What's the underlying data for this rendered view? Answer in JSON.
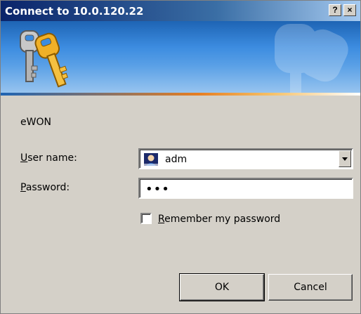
{
  "window": {
    "title": "Connect to 10.0.120.22",
    "help_label": "?",
    "close_label": "×"
  },
  "dialog": {
    "realm": "eWON",
    "username_label_first": "U",
    "username_label_rest": "ser name:",
    "username_value": "adm",
    "password_label_first": "P",
    "password_label_rest": "assword:",
    "password_value": "•••",
    "remember_label_first": "R",
    "remember_label_rest": "emember my password",
    "remember_checked": false
  },
  "buttons": {
    "ok": "OK",
    "cancel": "Cancel"
  },
  "colors": {
    "titlebar": "#0a246a",
    "face": "#d4d0c8",
    "banner_blue": "#3c8ce0",
    "accent_orange": "#e67e22"
  },
  "icons": {
    "banner": "keys-icon",
    "user": "user-icon"
  }
}
